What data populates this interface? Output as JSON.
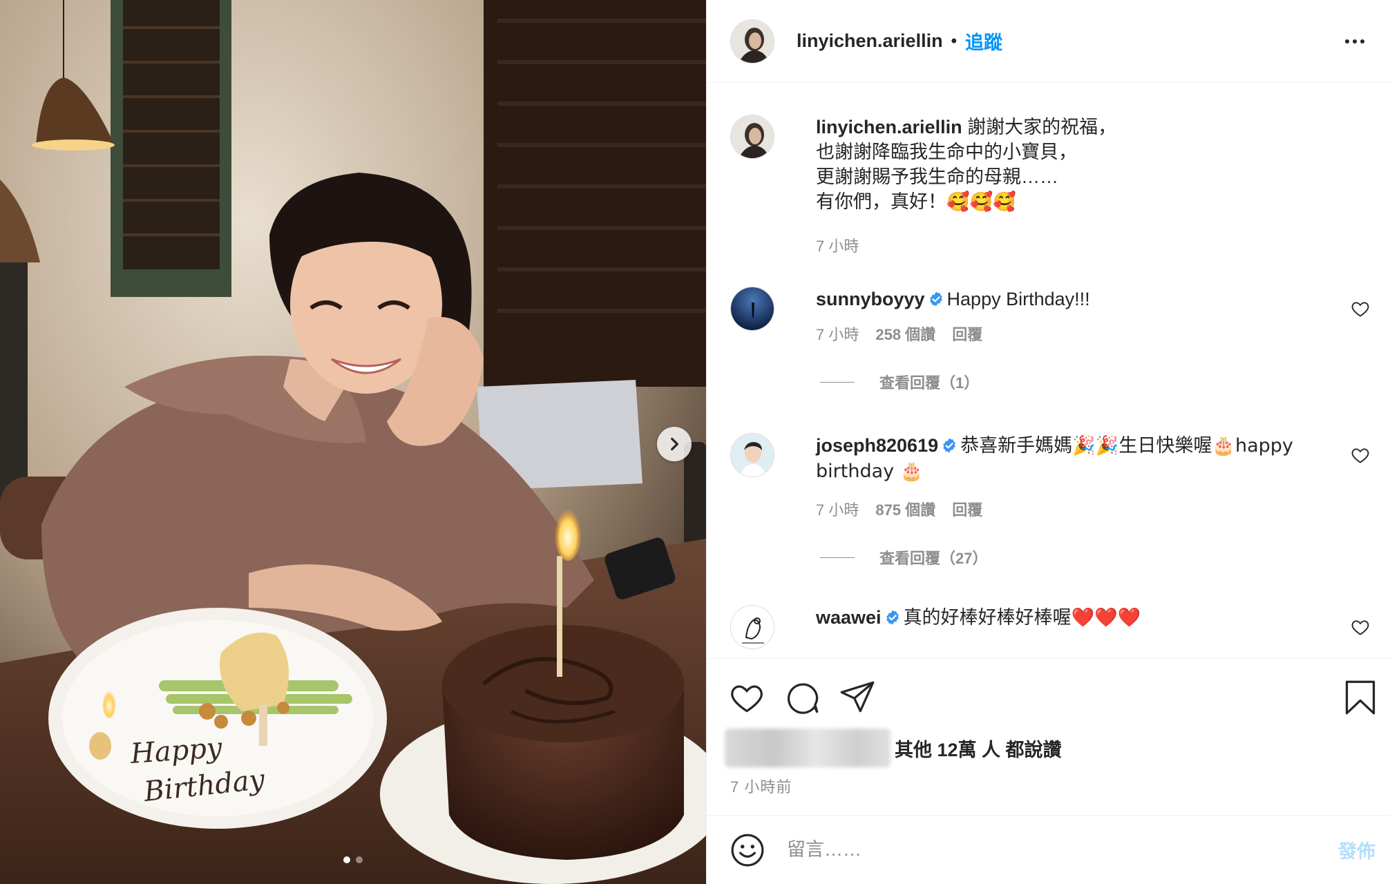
{
  "post": {
    "username": "linyichen.ariellin",
    "separator": "•",
    "follow_label": "追蹤",
    "more_label": "更多選項"
  },
  "caption": {
    "username": "linyichen.ariellin",
    "line1": "謝謝大家的祝福，",
    "line2": "也謝謝降臨我生命中的小寶貝，",
    "line3": "更謝謝賜予我生命的母親……",
    "line4": "有你們，真好！🥰🥰🥰",
    "time": "7 小時"
  },
  "comments": [
    {
      "username": "sunnyboyyy",
      "verified": true,
      "text": "Happy Birthday!!!",
      "time": "7 小時",
      "likes": "258 個讚",
      "reply_label": "回覆",
      "view_replies": "查看回覆（1）"
    },
    {
      "username": "joseph820619",
      "verified": true,
      "text": "恭喜新手媽媽🎉🎉生日快樂喔🎂happy birthday 🎂",
      "time": "7 小時",
      "likes": "875 個讚",
      "reply_label": "回覆",
      "view_replies": "查看回覆（27）"
    },
    {
      "username": "waawei",
      "verified": true,
      "text": "真的好棒好棒好棒喔❤️❤️❤️"
    }
  ],
  "likes_summary": {
    "text": "其他 12萬 人 都說讚"
  },
  "post_time": "7 小時前",
  "comment_box": {
    "placeholder": "留言……",
    "post_label": "發佈"
  },
  "photo": {
    "plate_text_line1": "Happy",
    "plate_text_line2": "Birthday",
    "carousel_count": 2,
    "carousel_active": 1
  },
  "icons": {
    "like": "heart-icon",
    "comment": "comment-bubble-icon",
    "share": "paper-plane-icon",
    "save": "bookmark-icon",
    "emoji": "smiley-icon",
    "verified": "verified-badge-icon",
    "next": "chevron-right-icon"
  },
  "colors": {
    "accent": "#0095f6",
    "verified": "#3897f0",
    "muted": "#8e8e8e",
    "text": "#262626",
    "post_button_disabled": "#b2dffc"
  }
}
